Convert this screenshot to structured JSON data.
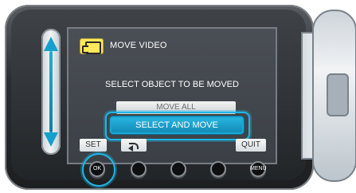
{
  "screen": {
    "header": {
      "title": "MOVE VIDEO",
      "icon": "film-icon"
    },
    "prompt": "SELECT OBJECT TO BE MOVED",
    "options": {
      "move_all": "MOVE ALL",
      "select_and_move": "SELECT AND MOVE"
    },
    "bottom_bar": {
      "set": "SET",
      "back_icon": "back-icon",
      "quit": "QUIT"
    }
  },
  "hardware": {
    "ok": "OK",
    "menu": "MENU"
  },
  "colors": {
    "accent": "#1fb6e6",
    "header_badge": "#ffe95a"
  }
}
